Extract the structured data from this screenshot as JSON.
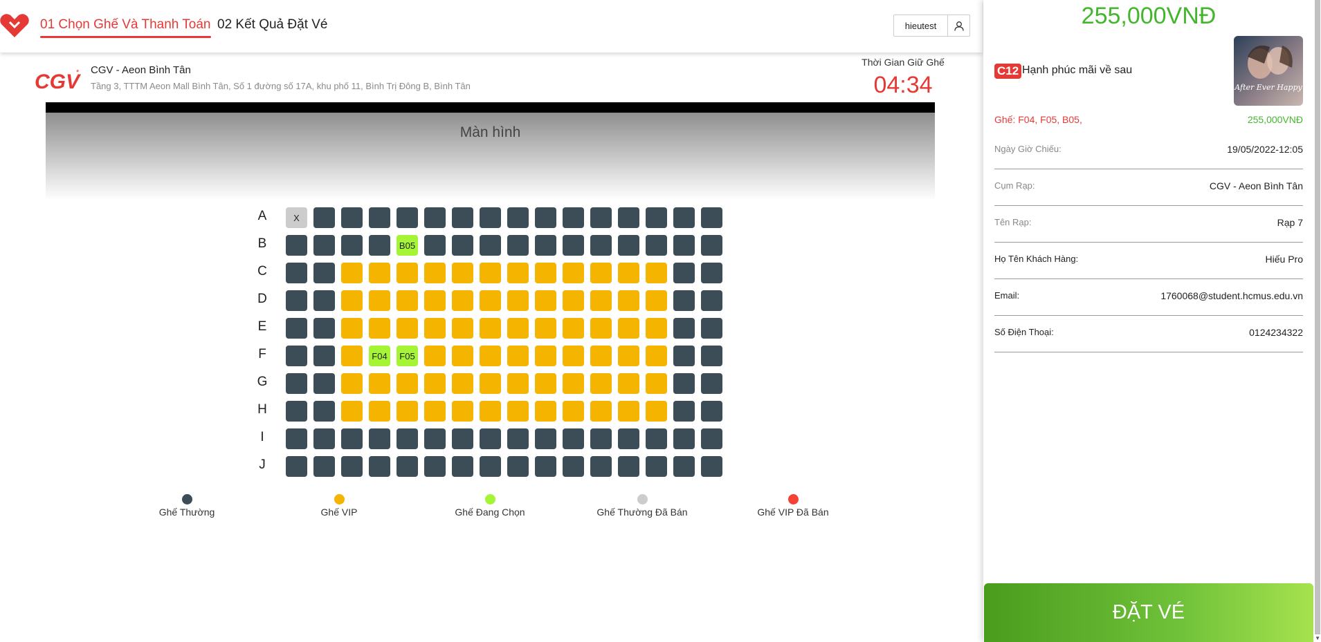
{
  "header": {
    "steps": [
      "01 Chọn Ghế Và Thanh Toán",
      "02 Kết Quả Đặt Vé"
    ],
    "username": "hieutest",
    "brand_color": "#e53935"
  },
  "cinema": {
    "name": "CGV - Aeon Bình Tân",
    "address": "Tầng 3, TTTM Aeon Mall Bình Tân, Số 1 đường số 17A, khu phố 11, Bình Trị Đông B, Bình Tân",
    "hold_label": "Thời Gian Giữ Ghế",
    "hold_time": "04:34",
    "screen_label": "Màn hình"
  },
  "seat_map": {
    "rows": [
      "A",
      "B",
      "C",
      "D",
      "E",
      "F",
      "G",
      "H",
      "I",
      "J"
    ],
    "cols_per_row": 16,
    "vip_rows": [
      "C",
      "D",
      "E",
      "F",
      "G",
      "H"
    ],
    "vip_col_range": [
      3,
      14
    ],
    "sold_seats": [
      {
        "row": "A",
        "col": 1,
        "label": "X"
      }
    ],
    "selected_seats": [
      {
        "row": "B",
        "col": 5,
        "label": "B05"
      },
      {
        "row": "F",
        "col": 4,
        "label": "F04"
      },
      {
        "row": "F",
        "col": 5,
        "label": "F05"
      }
    ],
    "colors": {
      "normal": "#3c4d57",
      "vip": "#f5b400",
      "selected": "#a6f436",
      "sold": "#cccccc",
      "vip_sold": "#f44336"
    }
  },
  "legend": [
    {
      "label": "Ghế Thường",
      "color": "#3c4d57"
    },
    {
      "label": "Ghế VIP",
      "color": "#f5b400"
    },
    {
      "label": "Ghế Đang Chọn",
      "color": "#a6f436"
    },
    {
      "label": "Ghế Thường Đã Bán",
      "color": "#cccccc"
    },
    {
      "label": "Ghế VIP Đã Bán",
      "color": "#f44336"
    }
  ],
  "summary": {
    "total": "255,000VNĐ",
    "rating": "C12",
    "movie_title": "Hạnh phúc mãi về sau",
    "poster_text": "After Ever Happy",
    "seats_text": "Ghế: F04,   F05,   B05,",
    "seats_price": "255,000VNĐ",
    "details": [
      {
        "label": "Ngày Giờ Chiếu:",
        "value": "19/05/2022-12:05"
      },
      {
        "label": "Cụm Rạp:",
        "value": "CGV - Aeon Bình Tân"
      },
      {
        "label": "Tên Rạp:",
        "value": "Rạp 7"
      },
      {
        "label": "Họ Tên Khách Hàng:",
        "value": "Hiếu Pro"
      },
      {
        "label": "Email:",
        "value": "1760068@student.hcmus.edu.vn"
      },
      {
        "label": "Số Điện Thoại:",
        "value": "0124234322"
      }
    ],
    "book_button": "ĐẶT VÉ"
  }
}
